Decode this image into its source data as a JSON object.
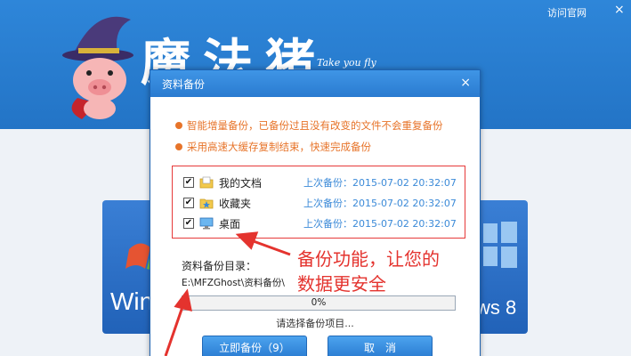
{
  "app": {
    "visit_site": "访问官网",
    "window_close": "×",
    "logo_text": "魔法猪",
    "tagline": "Take you fly",
    "tile_left_label": "Win",
    "tile_right_label": "ws 8"
  },
  "dialog": {
    "title": "资料备份",
    "close": "×",
    "bullets": [
      "智能增量备份，已备份过且没有改变的文件不会重复备份",
      "采用高速大缓存复制结束，快速完成备份"
    ],
    "items": [
      {
        "name": "我的文档",
        "last_backup": "上次备份：2015-07-02 20:32:07",
        "checked": true,
        "icon": "folder-documents-icon"
      },
      {
        "name": "收藏夹",
        "last_backup": "上次备份：2015-07-02 20:32:07",
        "checked": true,
        "icon": "folder-favorites-icon"
      },
      {
        "name": "桌面",
        "last_backup": "上次备份：2015-07-02 20:32:07",
        "checked": true,
        "icon": "desktop-icon"
      }
    ],
    "checkbox_mark": "✔",
    "backup_dir_label": "资料备份目录：",
    "backup_dir_path": "E:\\MFZGhost\\资料备份\\",
    "progress_text": "0%",
    "progress_fraction": 0.0,
    "status": "请选择备份项目...",
    "backup_button": "立即备份（9）",
    "cancel_button": "取　消"
  },
  "annotation": {
    "line1": "备份功能，让您的",
    "line2": "数据更安全",
    "color": "#e4332e"
  },
  "colors": {
    "header_blue": "#2a7bd0",
    "bullet_orange": "#e7742a",
    "timestamp_blue": "#3b8ad8"
  }
}
